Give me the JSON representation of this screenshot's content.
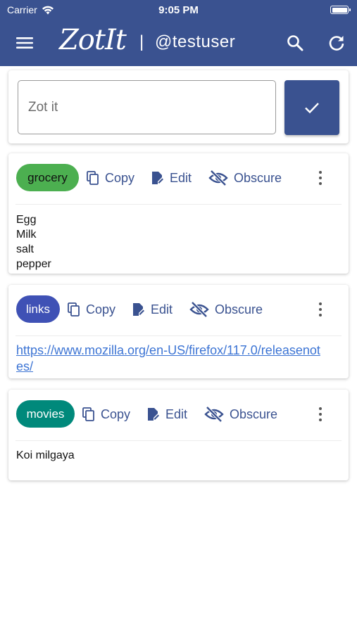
{
  "status": {
    "carrier": "Carrier",
    "time": "9:05 PM"
  },
  "header": {
    "logo": "ZotIt",
    "separator": "|",
    "username": "@testuser"
  },
  "compose": {
    "placeholder": "Zot it",
    "value": ""
  },
  "actions": {
    "copy": "Copy",
    "edit": "Edit",
    "obscure": "Obscure"
  },
  "colors": {
    "primary": "#3a5290",
    "grocery": "#4caf50",
    "links": "#3f51b5",
    "movies": "#00897b",
    "link": "#3c74d4"
  },
  "notes": [
    {
      "tag": "grocery",
      "lines": [
        "Egg",
        "Milk",
        "salt",
        "pepper"
      ]
    },
    {
      "tag": "links",
      "link": "https://www.mozilla.org/en-US/firefox/117.0/releasenotes/"
    },
    {
      "tag": "movies",
      "lines": [
        "Koi milgaya"
      ]
    }
  ]
}
